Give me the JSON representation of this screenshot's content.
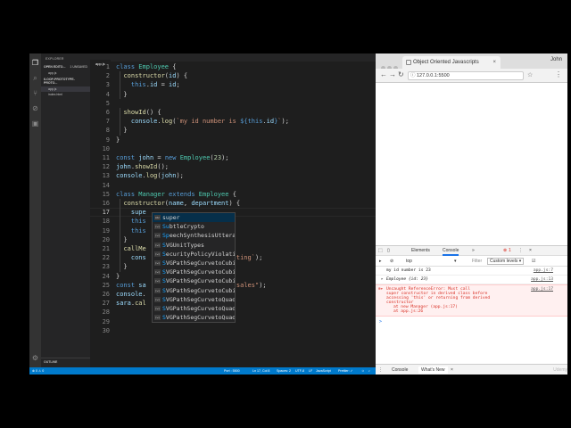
{
  "vscode": {
    "explorer_title": "EXPLORER",
    "open_editors_label": "OPEN EDITO...",
    "open_editors_badge": "1 UNSAVED",
    "open_file": "app.js",
    "project_label": "6-OOP-PROTOTYPE-PROTO...",
    "files": [
      "app.js",
      "index.html"
    ],
    "outline_label": "OUTLINE",
    "tab": "app.js",
    "line_numbers": [
      "1",
      "2",
      "3",
      "4",
      "5",
      "6",
      "7",
      "8",
      "9",
      "10",
      "11",
      "12",
      "13",
      "14",
      "15",
      "16",
      "17",
      "18",
      "19",
      "20",
      "21",
      "22",
      "23",
      "24",
      "25",
      "26",
      "27",
      "28",
      "29",
      "30"
    ],
    "suggestions": [
      {
        "kind": "abc",
        "text": "super",
        "match": ""
      },
      {
        "kind": "(w)",
        "text": "btleCrypto",
        "match": "Su"
      },
      {
        "kind": "(w)",
        "text": "eechSynthesisUtteranc",
        "match": "Sp"
      },
      {
        "kind": "(w)",
        "text": "VGUnitTypes",
        "match": "S"
      },
      {
        "kind": "(w)",
        "text": "ecurityPolicyViolation",
        "match": "S"
      },
      {
        "kind": "(w)",
        "text": "VGPathSegCurvetoCubicA",
        "match": "S"
      },
      {
        "kind": "(w)",
        "text": "VGPathSegCurvetoCubicR",
        "match": "S"
      },
      {
        "kind": "(w)",
        "text": "VGPathSegCurvetoCubicS",
        "match": "S"
      },
      {
        "kind": "(w)",
        "text": "VGPathSegCurvetoCubicS",
        "match": "S"
      },
      {
        "kind": "(w)",
        "text": "VGPathSegCurvetoQuadra",
        "match": "S"
      },
      {
        "kind": "(w)",
        "text": "VGPathSegCurvetoQuadra",
        "match": "S"
      },
      {
        "kind": "(w)",
        "text": "VGPathSegCurvetoQuadra",
        "match": "S"
      }
    ],
    "status": {
      "left": "⊗ 0 ⚠ 0",
      "port": "Port : 5500",
      "position": "Ln 17, Col 8",
      "spaces": "Spaces: 2",
      "encoding": "UTF-8",
      "eol": "LF",
      "language": "JavaScript",
      "prettier": "Prettier: ✓"
    }
  },
  "chrome": {
    "tab_title": "Object Oriented Javascripts",
    "user": "John",
    "url": "127.0.0.1:5500",
    "devtools": {
      "tabs": [
        "Elements",
        "Console"
      ],
      "more": "»",
      "error_count": "1",
      "context": "top",
      "filter": "Filter",
      "levels": "Custom levels ▾",
      "logs": [
        {
          "text": "my id number is 23",
          "src": "app.js:7"
        },
        {
          "text": "Employee {id: 23}",
          "src": "app.js:13"
        }
      ],
      "error": {
        "line1": "Uncaught ReferenceError: Must call",
        "line2": "super constructor in derived class before",
        "line3": "accessing 'this' or returning from derived",
        "line4": "constructor",
        "at1": "at new Manager (app.js:17)",
        "at2": "at app.js:26",
        "src": "app.js:17"
      },
      "prompt": ">",
      "drawer_tabs": [
        "Console",
        "What's New"
      ]
    }
  },
  "watermark": "Udemy"
}
